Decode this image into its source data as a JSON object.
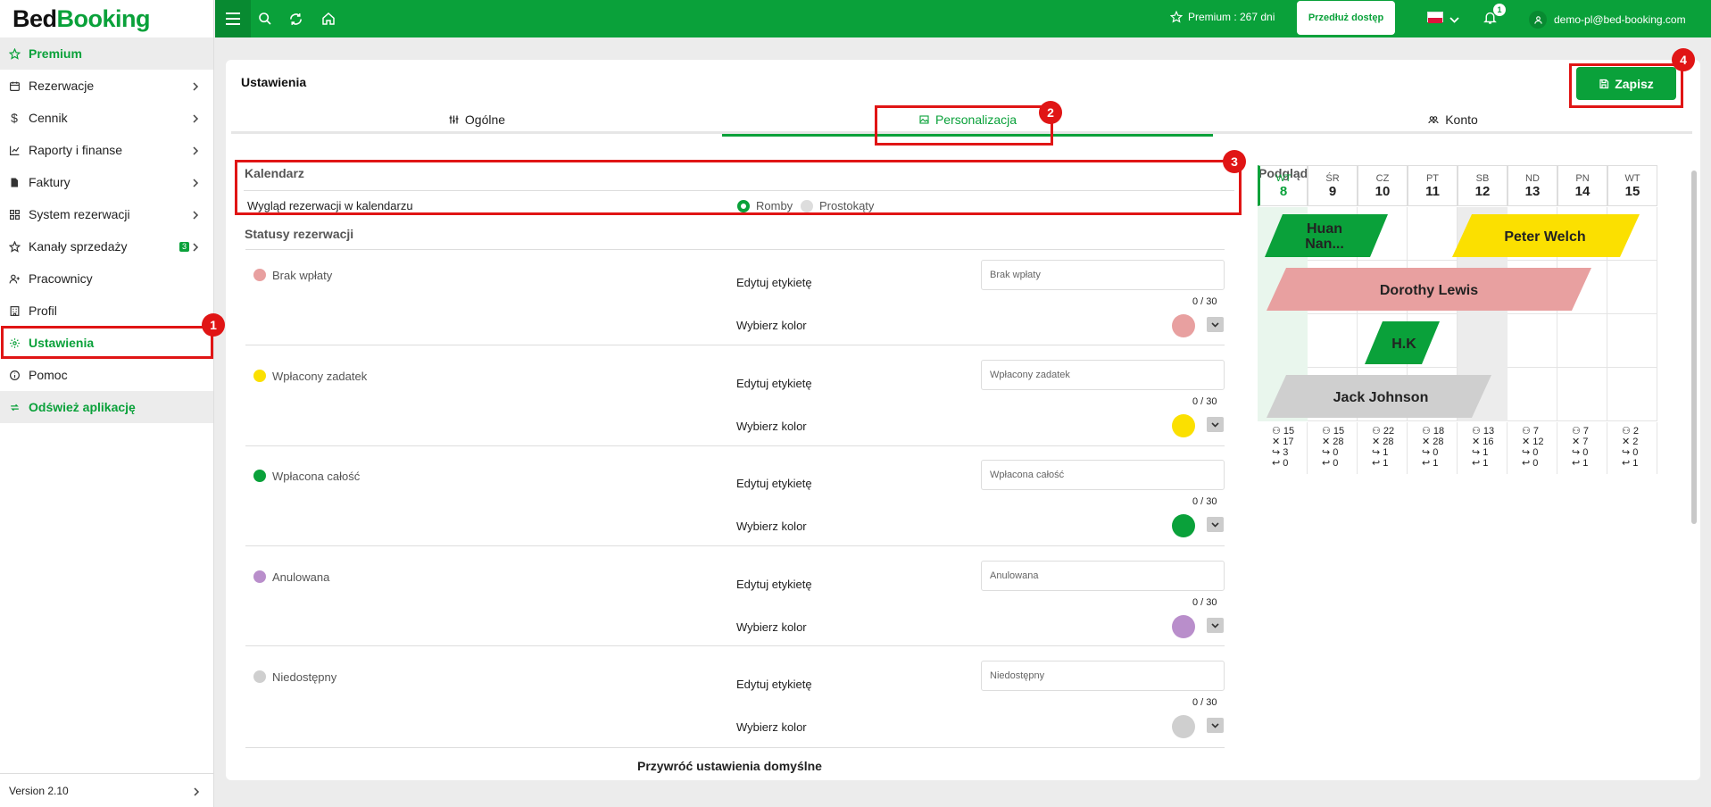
{
  "app": {
    "logo_part1": "Bed",
    "logo_part2": "Booking",
    "version": "Version 2.10"
  },
  "sidebar": {
    "items": [
      {
        "label": "Premium",
        "icon": "star-icon"
      },
      {
        "label": "Rezerwacje",
        "icon": "calendar-icon"
      },
      {
        "label": "Cennik",
        "icon": "dollar-icon"
      },
      {
        "label": "Raporty i finanse",
        "icon": "chart-icon"
      },
      {
        "label": "Faktury",
        "icon": "invoice-icon"
      },
      {
        "label": "System rezerwacji",
        "icon": "grid-icon"
      },
      {
        "label": "Kanały sprzedaży",
        "icon": "tag-icon",
        "badge": "3"
      },
      {
        "label": "Pracownicy",
        "icon": "user-add-icon"
      },
      {
        "label": "Profil",
        "icon": "building-icon"
      },
      {
        "label": "Ustawienia",
        "icon": "gear-icon"
      },
      {
        "label": "Pomoc",
        "icon": "info-icon"
      },
      {
        "label": "Odśwież aplikację",
        "icon": "refresh-icon"
      }
    ]
  },
  "topbar": {
    "premium_text": "Premium : 267 dni",
    "extend_label": "Przedłuż dostęp",
    "notifications_count": "1",
    "user_email": "demo-pl@bed-booking.com"
  },
  "page": {
    "title": "Ustawienia",
    "save_label": "Zapisz",
    "tabs": [
      {
        "label": "Ogólne"
      },
      {
        "label": "Personalizacja"
      },
      {
        "label": "Konto"
      }
    ],
    "calendar": {
      "title": "Kalendarz",
      "appearance_label": "Wygląd rezerwacji w kalendarzu",
      "option_diamonds": "Romby",
      "option_rectangles": "Prostokąty",
      "selected": "Romby"
    },
    "statuses_title": "Statusy rezerwacji",
    "edit_label_text": "Edytuj etykietę",
    "choose_color_text": "Wybierz kolor",
    "statuses": [
      {
        "name": "Brak wpłaty",
        "placeholder": "Brak wpłaty",
        "counter": "0 / 30",
        "color": "#e8a0a0"
      },
      {
        "name": "Wpłacony zadatek",
        "placeholder": "Wpłacony zadatek",
        "counter": "0 / 30",
        "color": "#fbe000"
      },
      {
        "name": "Wpłacona całość",
        "placeholder": "Wpłacona całość",
        "counter": "0 / 30",
        "color": "#0aa13a"
      },
      {
        "name": "Anulowana",
        "placeholder": "Anulowana",
        "counter": "0 / 30",
        "color": "#b98ecb"
      },
      {
        "name": "Niedostępny",
        "placeholder": "Niedostępny",
        "counter": "0 / 30",
        "color": "#cfcfcf"
      }
    ],
    "restore_label": "Przywróć ustawienia domyślne"
  },
  "preview": {
    "title": "Podgląd",
    "days": [
      {
        "name": "WT",
        "num": "8"
      },
      {
        "name": "ŚR",
        "num": "9"
      },
      {
        "name": "CZ",
        "num": "10"
      },
      {
        "name": "PT",
        "num": "11"
      },
      {
        "name": "SB",
        "num": "12"
      },
      {
        "name": "ND",
        "num": "13"
      },
      {
        "name": "PN",
        "num": "14"
      },
      {
        "name": "WT",
        "num": "15"
      }
    ],
    "reservations": {
      "r1": "Huan Nan...",
      "r2": "Peter Welch",
      "r3": "Dorothy Lewis",
      "r4": "H.K",
      "r5": "Jack Johnson"
    },
    "stats": [
      [
        "15",
        "17",
        "3",
        "0"
      ],
      [
        "15",
        "28",
        "0",
        "0"
      ],
      [
        "22",
        "28",
        "1",
        "1"
      ],
      [
        "18",
        "28",
        "0",
        "1"
      ],
      [
        "13",
        "16",
        "1",
        "1"
      ],
      [
        "7",
        "12",
        "0",
        "0"
      ],
      [
        "7",
        "7",
        "0",
        "1"
      ],
      [
        "2",
        "2",
        "0",
        "1"
      ]
    ]
  },
  "annotations": [
    "1",
    "2",
    "3",
    "4"
  ],
  "colors": {
    "brand": "#0aa13a",
    "highlight": "#e01515"
  }
}
